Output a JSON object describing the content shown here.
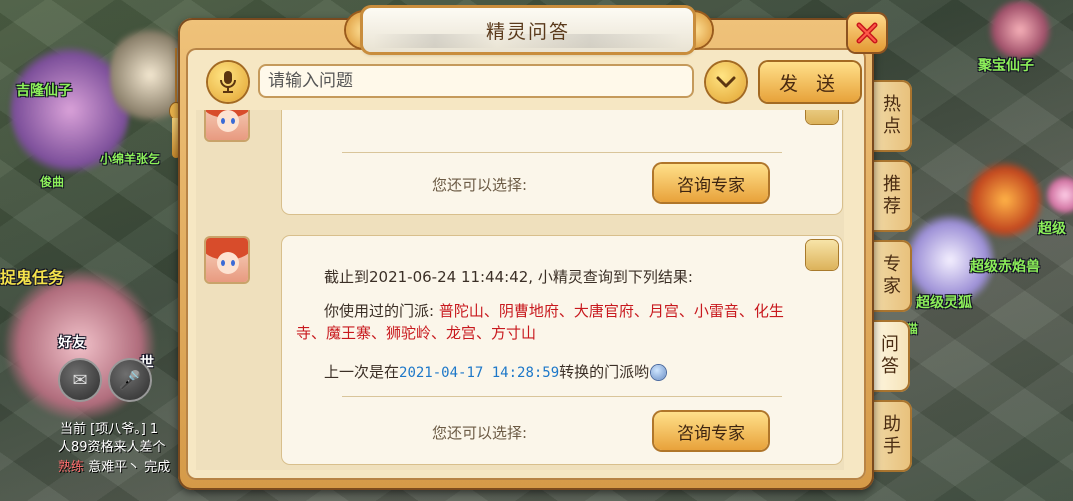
{
  "dialog": {
    "title": "精灵问答",
    "search_placeholder": "请输入问题",
    "send_label": "发 送"
  },
  "side_tabs": [
    {
      "label": "热点",
      "active": false
    },
    {
      "label": "推荐",
      "active": false
    },
    {
      "label": "专家",
      "active": false
    },
    {
      "label": "问答",
      "active": true
    },
    {
      "label": "助手",
      "active": false
    }
  ],
  "card1": {
    "choose_label": "您还可以选择:",
    "expert_label": "咨询专家"
  },
  "card2": {
    "line1": "截止到2021-06-24 11:44:42, 小精灵查询到下列结果:",
    "line2_prefix": "你使用过的门派: ",
    "sects": "普陀山、阴曹地府、大唐官府、月宫、小雷音、化生寺、魔王寨、狮驼岭、龙宫、方寸山",
    "line3_prefix": "上一次是在",
    "line3_time": "2021-04-17 14:28:59",
    "line3_suffix": "转换的门派哟",
    "choose_label": "您还可以选择:",
    "expert_label": "咨询专家"
  },
  "background": {
    "names": [
      "吉隆仙子",
      "聚宝仙子",
      "超级",
      "超级赤焰兽",
      "超级灵狐",
      "捉鬼任务",
      "好友",
      "世",
      "小绵羊张乞",
      "俊曲",
      "猫"
    ],
    "chat_lines": [
      "当前 [项八爷。] 1",
      "人89资格来人差个",
      "意难平丶 完成"
    ],
    "chat_highlight": "熟练"
  },
  "colors": {
    "sect_red": "#c8191e",
    "time_blue": "#1d78c9",
    "frame_gold": "#e4ab5a"
  }
}
